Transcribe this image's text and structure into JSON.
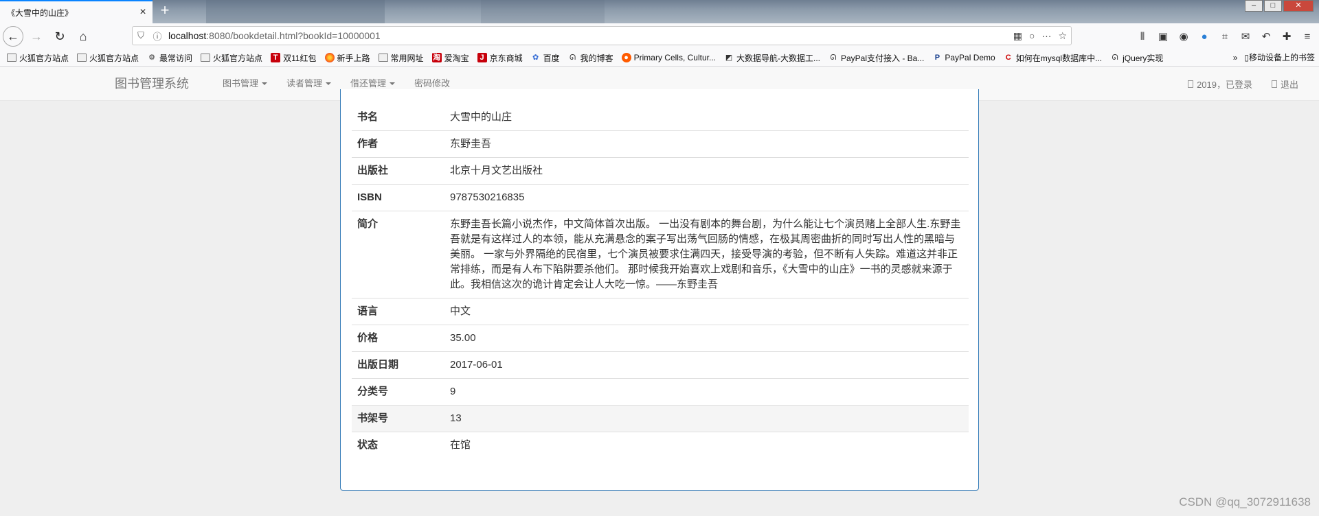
{
  "browser": {
    "tab_title": "《大雪中的山庄》",
    "tab_close": "×",
    "new_tab": "+",
    "url_host": "localhost",
    "url_rest": ":8080/bookdetail.html?bookId=10000001",
    "bookmarks": [
      {
        "label": "火狐官方站点",
        "icon": "folder-icon"
      },
      {
        "label": "火狐官方站点",
        "icon": "folder-icon"
      },
      {
        "label": "最常访问",
        "icon": "gear-icon"
      },
      {
        "label": "火狐官方站点",
        "icon": "folder-icon"
      },
      {
        "label": "双11红包",
        "icon": "tmall-icon"
      },
      {
        "label": "新手上路",
        "icon": "firefox-icon"
      },
      {
        "label": "常用网址",
        "icon": "folder-icon"
      },
      {
        "label": "爱淘宝",
        "icon": "taobao-icon"
      },
      {
        "label": "京东商城",
        "icon": "jd-icon"
      },
      {
        "label": "百度",
        "icon": "baidu-icon"
      },
      {
        "label": "我的博客",
        "icon": "blog-icon"
      },
      {
        "label": "Primary Cells, Cultur...",
        "icon": "record-icon"
      },
      {
        "label": "大数据导航-大数据工...",
        "icon": "bigdata-icon"
      },
      {
        "label": "PayPal支付接入 - Ba...",
        "icon": "blog-icon"
      },
      {
        "label": "PayPal Demo",
        "icon": "paypal-icon"
      },
      {
        "label": "如何在mysql数据库中...",
        "icon": "csdn-icon"
      },
      {
        "label": "jQuery实现",
        "icon": "blog-icon"
      }
    ],
    "bookmarks_more": "»",
    "mobile_bookmarks": "移动设备上的书签"
  },
  "app": {
    "brand": "图书管理系统",
    "menu": [
      {
        "label": "图书管理",
        "dropdown": true
      },
      {
        "label": "读者管理",
        "dropdown": true
      },
      {
        "label": "借还管理",
        "dropdown": true
      },
      {
        "label": "密码修改",
        "dropdown": false
      }
    ],
    "user_status": "2019，已登录",
    "logout": "退出"
  },
  "book": {
    "rows": [
      {
        "key": "书名",
        "value": "大雪中的山庄"
      },
      {
        "key": "作者",
        "value": "东野圭吾"
      },
      {
        "key": "出版社",
        "value": "北京十月文艺出版社"
      },
      {
        "key": "ISBN",
        "value": "9787530216835"
      },
      {
        "key": "简介",
        "value": "东野圭吾长篇小说杰作，中文简体首次出版。 一出没有剧本的舞台剧，为什么能让七个演员赌上全部人生.东野圭吾就是有这样过人的本领，能从充满悬念的案子写出荡气回肠的情感，在极其周密曲折的同时写出人性的黑暗与美丽。 一家与外界隔绝的民宿里，七个演员被要求住满四天，接受导演的考验，但不断有人失踪。难道这并非正常排练，而是有人布下陷阱要杀他们。 那时候我开始喜欢上戏剧和音乐，《大雪中的山庄》一书的灵感就来源于此。我相信这次的诡计肯定会让人大吃一惊。——东野圭吾"
      },
      {
        "key": "语言",
        "value": "中文"
      },
      {
        "key": "价格",
        "value": "35.00"
      },
      {
        "key": "出版日期",
        "value": "2017-06-01"
      },
      {
        "key": "分类号",
        "value": "9"
      },
      {
        "key": "书架号",
        "value": "13"
      },
      {
        "key": "状态",
        "value": "在馆"
      }
    ]
  },
  "watermark": "CSDN @qq_3072911638"
}
